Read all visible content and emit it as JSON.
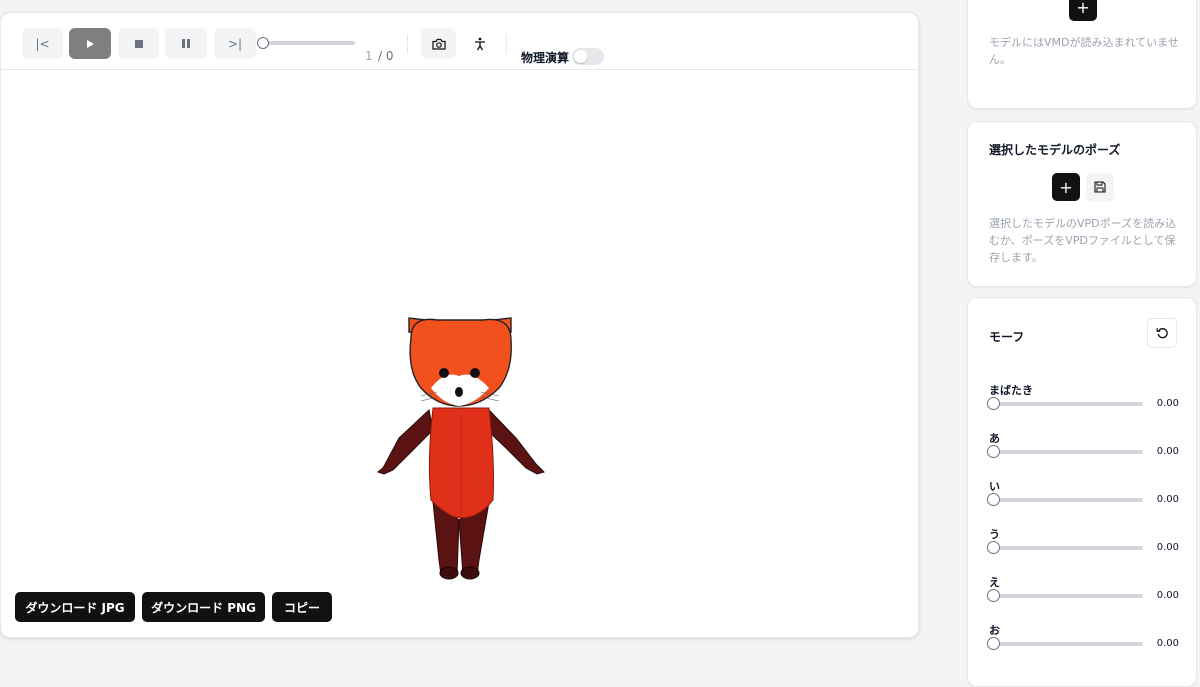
{
  "toolbar": {
    "first_frame": "|<",
    "last_frame": ">|",
    "seek_progress": 0,
    "frame_current": "1",
    "frame_total": "/ 0",
    "physics_label": "物理演算",
    "physics_enabled": false
  },
  "downloads": {
    "jpg": "ダウンロード JPG",
    "png": "ダウンロード PNG",
    "copy": "コピー"
  },
  "motion_card": {
    "description": "モデルにはVMDが読み込まれていません。"
  },
  "pose_card": {
    "title": "選択したモデルのポーズ",
    "description": "選択したモデルのVPDポーズを読み込むか、ポーズをVPDファイルとして保存します。"
  },
  "morph_card": {
    "title": "モーフ",
    "items": [
      {
        "label": "まばたき",
        "value": "0.00",
        "level": 0
      },
      {
        "label": "あ",
        "value": "0.00",
        "level": 0
      },
      {
        "label": "い",
        "value": "0.00",
        "level": 0
      },
      {
        "label": "う",
        "value": "0.00",
        "level": 0
      },
      {
        "label": "え",
        "value": "0.00",
        "level": 0
      },
      {
        "label": "お",
        "value": "0.00",
        "level": 0
      }
    ]
  },
  "icons": {
    "first": "skip-to-start-icon",
    "play": "play-icon",
    "stop": "stop-icon",
    "pause": "pause-icon",
    "last": "skip-to-end-icon",
    "camera": "camera-icon",
    "pose": "person-pose-icon",
    "add": "plus-icon",
    "save": "floppy-disk-icon",
    "reset": "reset-icon"
  },
  "colors": {
    "background": "#f3f4f6",
    "dark_button": "#111111",
    "play_button": "#7f7f7f",
    "model_fur": "#e1301a",
    "model_limbs": "#5a1212"
  }
}
